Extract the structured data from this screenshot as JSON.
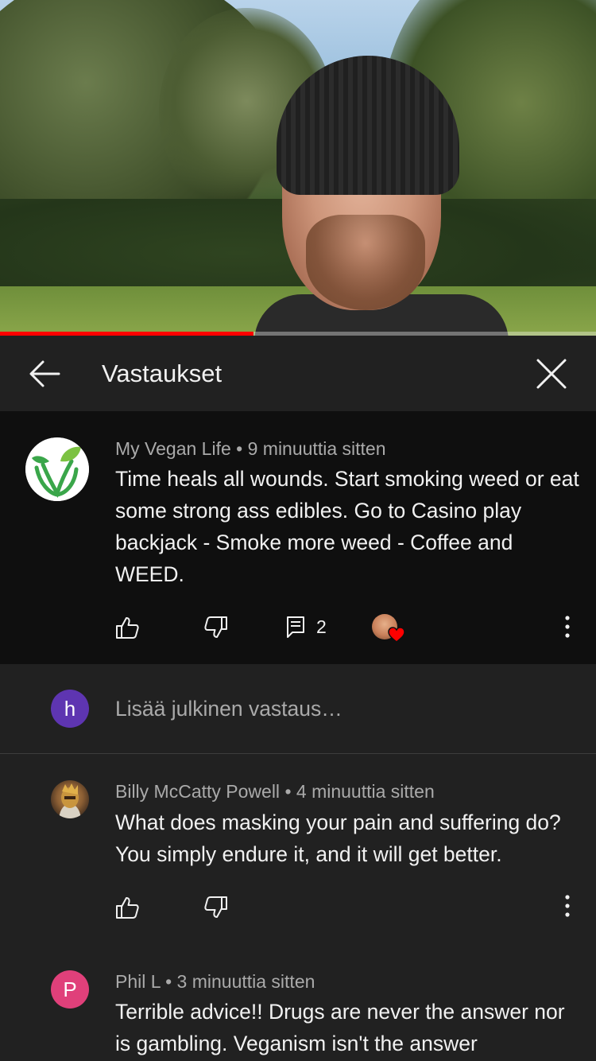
{
  "video": {
    "progress_fraction": 0.425
  },
  "header": {
    "title": "Vastaukset",
    "back_icon": "arrow-left-icon",
    "close_icon": "close-icon"
  },
  "parent_comment": {
    "author": "My Vegan Life",
    "separator": "•",
    "time": "9 minuuttia sitten",
    "text": "Time heals all wounds. Start smoking weed or eat some strong ass edibles. Go to Casino play backjack - Smoke more weed - Coffee and WEED.",
    "reply_count": "2",
    "avatar_icon": "vegan-logo-icon",
    "heart_color": "#ff0000"
  },
  "reply_input": {
    "avatar_letter": "h",
    "placeholder": "Lisää julkinen vastaus…"
  },
  "replies": [
    {
      "author": "Billy McCatty Powell",
      "separator": "•",
      "time": "4 minuuttia sitten",
      "text": "What does masking your pain and suffering do? You simply endure it, and it will get better."
    },
    {
      "author": "Phil L",
      "separator": "•",
      "time": "3 minuuttia sitten",
      "avatar_letter": "P",
      "text": "Terrible advice!! Drugs are never the answer nor is gambling. Veganism isn't the answer"
    }
  ],
  "colors": {
    "progress": "#ff0000",
    "background": "#212121",
    "parent_background": "#0f0f0f",
    "text_secondary": "#aaaaaa"
  }
}
